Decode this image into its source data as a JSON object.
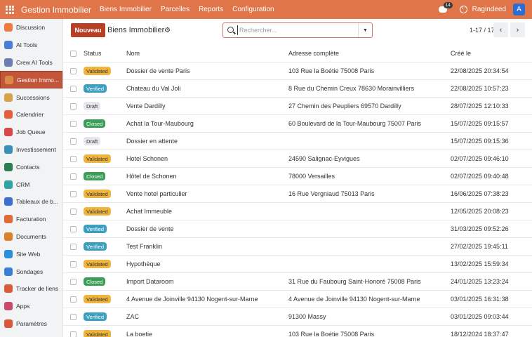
{
  "topbar": {
    "app_title": "Gestion Immobilier",
    "menu": [
      "Biens Immobilier",
      "Parcelles",
      "Reports",
      "Configuration"
    ],
    "chat_badge": "14",
    "username": "Ragindeed",
    "avatar_letter": "A"
  },
  "sidebar": {
    "items": [
      {
        "label": "Discussion",
        "color": "#f07b3f"
      },
      {
        "label": "AI Tools",
        "color": "#4a7fd4"
      },
      {
        "label": "Crew AI Tools",
        "color": "#6b7db3"
      },
      {
        "label": "Gestion Immo...",
        "color": "#d98b45"
      },
      {
        "label": "Successions",
        "color": "#d9a24a"
      },
      {
        "label": "Calendrier",
        "color": "#e85d3c"
      },
      {
        "label": "Job Queue",
        "color": "#d94848"
      },
      {
        "label": "Investissement",
        "color": "#3a8fb5"
      },
      {
        "label": "Contacts",
        "color": "#2e7d4f"
      },
      {
        "label": "CRM",
        "color": "#2ea3a3"
      },
      {
        "label": "Tableaux de b...",
        "color": "#3d6fd1"
      },
      {
        "label": "Facturation",
        "color": "#e06a3a"
      },
      {
        "label": "Documents",
        "color": "#d9822b"
      },
      {
        "label": "Site Web",
        "color": "#2b8fd9"
      },
      {
        "label": "Sondages",
        "color": "#3a7fd4"
      },
      {
        "label": "Tracker de liens",
        "color": "#d95b3a"
      },
      {
        "label": "Apps",
        "color": "#c94a6b"
      },
      {
        "label": "Paramètres",
        "color": "#d9583a"
      }
    ]
  },
  "control": {
    "new_button": "Nouveau",
    "breadcrumb": "Biens Immobilier",
    "search_placeholder": "Rechercher...",
    "pager": "1-17 / 17"
  },
  "table": {
    "headers": {
      "status": "Status",
      "nom": "Nom",
      "adresse": "Adresse complète",
      "cree": "Créé le"
    },
    "rows": [
      {
        "status": "Validated",
        "nom": "Dossier de vente Paris",
        "adresse": "103 Rue la Boétie 75008 Paris",
        "cree": "22/08/2025 20:34:54"
      },
      {
        "status": "Verified",
        "nom": "Chateau du Val Joli",
        "adresse": "8 Rue du Chemin Creux 78630 Morainvilliers",
        "cree": "22/08/2025 10:57:23"
      },
      {
        "status": "Draft",
        "nom": "Vente Dardilly",
        "adresse": "27 Chemin des Peupliers 69570 Dardilly",
        "cree": "28/07/2025 12:10:33"
      },
      {
        "status": "Closed",
        "nom": "Achat la Tour-Maubourg",
        "adresse": "60 Boulevard de la Tour-Maubourg 75007 Paris",
        "cree": "15/07/2025 09:15:57"
      },
      {
        "status": "Draft",
        "nom": "Dossier en attente",
        "adresse": "",
        "cree": "15/07/2025 09:15:36"
      },
      {
        "status": "Validated",
        "nom": "Hotel Schonen",
        "adresse": "24590 Salignac-Eyvigues",
        "cree": "02/07/2025 09:46:10"
      },
      {
        "status": "Closed",
        "nom": "Hôtel de Schonen",
        "adresse": "78000 Versailles",
        "cree": "02/07/2025 09:40:48"
      },
      {
        "status": "Validated",
        "nom": "Vente hotel particulier",
        "adresse": "16 Rue Vergniaud 75013 Paris",
        "cree": "16/06/2025 07:38:23"
      },
      {
        "status": "Validated",
        "nom": "Achat Immeuble",
        "adresse": "",
        "cree": "12/05/2025 20:08:23"
      },
      {
        "status": "Verified",
        "nom": "Dossier de vente",
        "adresse": "",
        "cree": "31/03/2025 09:52:26"
      },
      {
        "status": "Verified",
        "nom": "Test Franklin",
        "adresse": "",
        "cree": "27/02/2025 19:45:11"
      },
      {
        "status": "Validated",
        "nom": "Hypothèque",
        "adresse": "",
        "cree": "13/02/2025 15:59:34"
      },
      {
        "status": "Closed",
        "nom": "Import Dataroom",
        "adresse": "31 Rue du Faubourg Saint-Honoré 75008 Paris",
        "cree": "24/01/2025 13:23:24"
      },
      {
        "status": "Validated",
        "nom": "4 Avenue de Joinville 94130 Nogent-sur-Marne",
        "adresse": "4 Avenue de Joinville 94130 Nogent-sur-Marne",
        "cree": "03/01/2025 16:31:38"
      },
      {
        "status": "Verified",
        "nom": "ZAC",
        "adresse": "91300 Massy",
        "cree": "03/01/2025 09:03:44"
      },
      {
        "status": "Validated",
        "nom": "La boetie",
        "adresse": "103 Rue la Boétie 75008 Paris",
        "cree": "18/12/2024 18:37:47"
      }
    ]
  }
}
